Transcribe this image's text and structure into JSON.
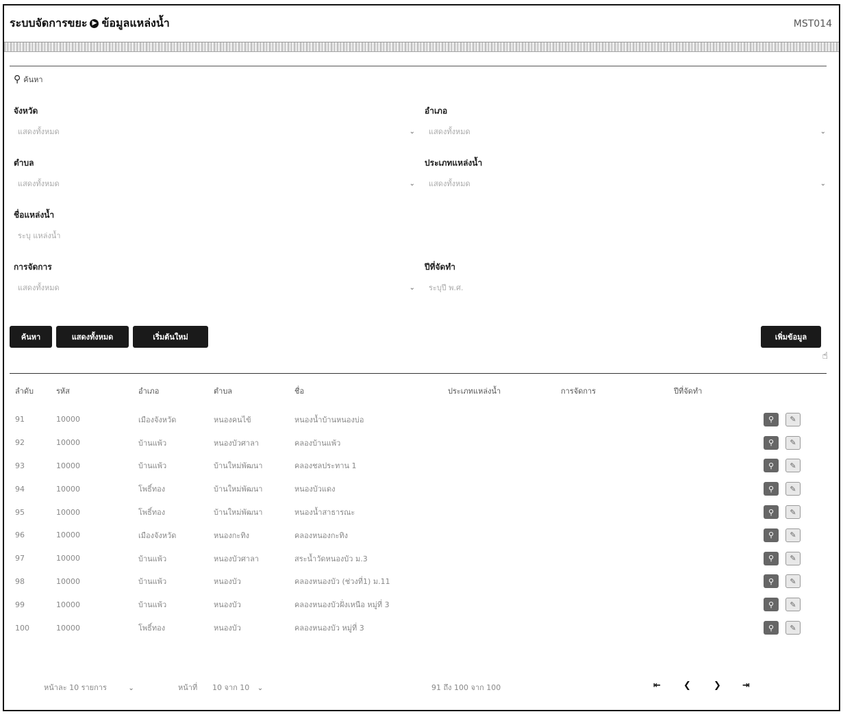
{
  "app": {
    "title": "ระบบจัดการขยะ",
    "section": "ข้อมูลแหล่งน้ำ",
    "code": "MST014"
  },
  "search": {
    "heading": "ค้นหา",
    "fields": {
      "province": {
        "label": "จังหวัด",
        "value": "แสดงทั้งหมด"
      },
      "district": {
        "label": "อำเภอ",
        "value": "แสดงทั้งหมด"
      },
      "subdistrict": {
        "label": "ตำบล",
        "value": "แสดงทั้งหมด"
      },
      "source_type": {
        "label": "ประเภทแหล่งน้ำ",
        "value": "แสดงทั้งหมด"
      },
      "source_name": {
        "label": "ชื่อแหล่งน้ำ",
        "placeholder": "ระบุ แหล่งน้ำ"
      },
      "management": {
        "label": "การจัดการ",
        "value": "แสดงทั้งหมด"
      },
      "year": {
        "label": "ปีที่จัดทำ",
        "placeholder": "ระบุปี พ.ศ."
      }
    },
    "buttons": {
      "search": "ค้นหา",
      "show_all": "แสดงทั้งหมด",
      "reset": "เริ่มต้นใหม่",
      "add": "เพิ่มข้อมูล"
    }
  },
  "table": {
    "columns": [
      "ลำดับ",
      "รหัส",
      "อำเภอ",
      "ตำบล",
      "ชื่อ",
      "ประเภทแหล่งน้ำ",
      "การจัดการ",
      "ปีที่จัดทำ"
    ],
    "rows": [
      {
        "no": "91",
        "code": "10000",
        "district": "เมืองจังหวัด",
        "subdistrict": "หนองคนไข้",
        "name": "หนองน้ำบ้านหนองบ่อ"
      },
      {
        "no": "92",
        "code": "10000",
        "district": "บ้านแพ้ว",
        "subdistrict": "หนองบัวศาลา",
        "name": "คลองบ้านแพ้ว"
      },
      {
        "no": "93",
        "code": "10000",
        "district": "บ้านแพ้ว",
        "subdistrict": "บ้านใหม่พัฒนา",
        "name": "คลองชลประทาน 1"
      },
      {
        "no": "94",
        "code": "10000",
        "district": "โพธิ์ทอง",
        "subdistrict": "บ้านใหม่พัฒนา",
        "name": "หนองบัวแดง"
      },
      {
        "no": "95",
        "code": "10000",
        "district": "โพธิ์ทอง",
        "subdistrict": "บ้านใหม่พัฒนา",
        "name": "หนองน้ำสาธารณะ"
      },
      {
        "no": "96",
        "code": "10000",
        "district": "เมืองจังหวัด",
        "subdistrict": "หนองกะทิง",
        "name": "คลองหนองกะทิง"
      },
      {
        "no": "97",
        "code": "10000",
        "district": "บ้านแพ้ว",
        "subdistrict": "หนองบัวศาลา",
        "name": "สระน้ำวัดหนองบัว ม.3"
      },
      {
        "no": "98",
        "code": "10000",
        "district": "บ้านแพ้ว",
        "subdistrict": "หนองบัว",
        "name": "คลองหนองบัว (ช่วงที่1) ม.11"
      },
      {
        "no": "99",
        "code": "10000",
        "district": "บ้านแพ้ว",
        "subdistrict": "หนองบัว",
        "name": "คลองหนองบัวฝั่งเหนือ หมู่ที่ 3"
      },
      {
        "no": "100",
        "code": "10000",
        "district": "โพธิ์ทอง",
        "subdistrict": "หนองบัว",
        "name": "คลองหนองบัว หมู่ที่ 3"
      }
    ]
  },
  "pager": {
    "page_size": "หน้าละ 10 รายการ",
    "page_label": "หน้าที่",
    "page_value": "10 จาก 10",
    "summary": "91 ถึง 100 จาก 100"
  },
  "icons": {
    "view": "search-icon",
    "edit": "edit-icon"
  }
}
